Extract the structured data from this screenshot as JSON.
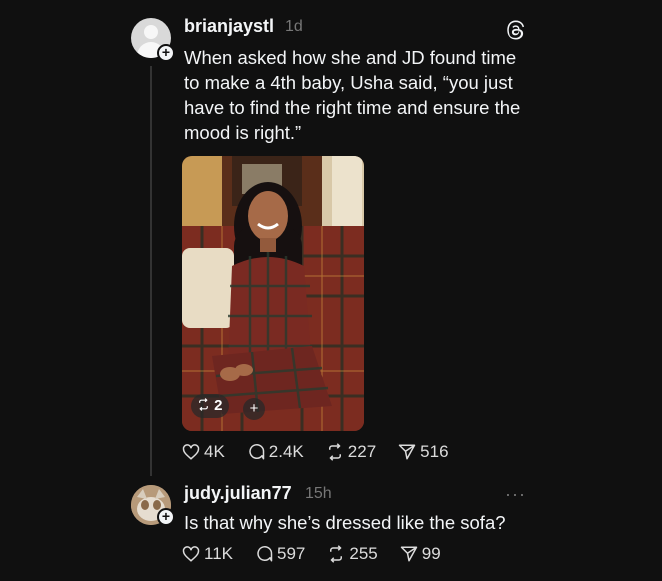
{
  "post": {
    "username": "brianjaystl",
    "time": "1d",
    "text": "When asked how she and JD found time to make a 4th baby, Usha said, “you just have to find the right time and ensure the mood is right.”",
    "media_repost_count": "2",
    "media_plus": "+",
    "stats": {
      "likes": "4K",
      "comments": "2.4K",
      "reposts": "227",
      "shares": "516"
    }
  },
  "reply": {
    "username": "judy.julian77",
    "time": "15h",
    "more": "···",
    "text": "Is that why she’s dressed like the sofa?",
    "stats": {
      "likes": "11K",
      "comments": "597",
      "reposts": "255",
      "shares": "99"
    }
  },
  "colors": {
    "background": "#101010",
    "text": "#f3f5f7",
    "muted": "#777777",
    "thread_line": "#333333"
  },
  "icons": [
    "threads-logo-icon",
    "heart-icon",
    "comment-icon",
    "repost-icon",
    "share-icon",
    "more-icon",
    "follow-plus-icon"
  ]
}
